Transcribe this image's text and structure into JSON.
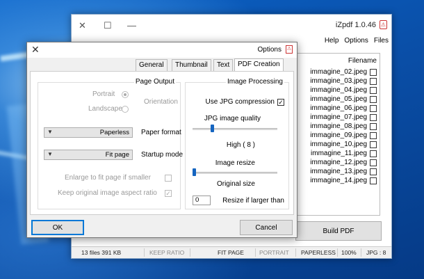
{
  "main_window": {
    "title": "iZpdf 1.0.46",
    "app_icon": "pdf-icon",
    "controls": {
      "close": "✕",
      "maximize": "☐",
      "minimize": "—"
    },
    "menu": [
      "Help",
      "Options",
      "Files"
    ],
    "file_list": {
      "header": "Filename",
      "files": [
        "immagine_02.jpeg",
        "immagine_03.jpeg",
        "immagine_04.jpeg",
        "immagine_05.jpeg",
        "immagine_06.jpeg",
        "immagine_07.jpeg",
        "immagine_08.jpeg",
        "immagine_09.jpeg",
        "immagine_10.jpeg",
        "immagine_11.jpeg",
        "immagine_12.jpeg",
        "immagine_13.jpeg",
        "immagine_14.jpeg"
      ]
    },
    "build_button": "Build PDF",
    "status": {
      "size": "13 files   391 KB",
      "ratio": "KEEP RATIO",
      "fit": "FIT PAGE",
      "orientation": "PORTRAIT",
      "format": "PAPERLESS",
      "zoom": "100%",
      "quality": "JPG : 8"
    }
  },
  "options_dialog": {
    "title": "Options",
    "close": "✕",
    "tabs": [
      "General",
      "Thumbnail",
      "Text",
      "PDF Creation"
    ],
    "active_tab": "PDF Creation",
    "image_processing": {
      "title": "Image Processing",
      "use_jpg": "Use JPG compression",
      "use_jpg_checked": true,
      "quality_label": "JPG image quality",
      "quality_value": "High ( 8 )",
      "quality_level": 8,
      "resize_label": "Image resize",
      "resize_value": "Original size",
      "resize_if_label": "Resize if larger than",
      "resize_if_value": "0"
    },
    "page_output": {
      "title": "Page Output",
      "orientation_label": "Orientation",
      "portrait": "Portrait",
      "landscape": "Landscape",
      "paper_format_label": "Paper format",
      "paper_format_value": "Paperless",
      "startup_mode_label": "Startup mode",
      "startup_mode_value": "Fit page",
      "enlarge": "Enlarge to fit page if smaller",
      "keep_ratio": "Keep original image aspect ratio",
      "keep_ratio_checked": true
    },
    "cancel": "Cancel",
    "ok": "OK"
  }
}
